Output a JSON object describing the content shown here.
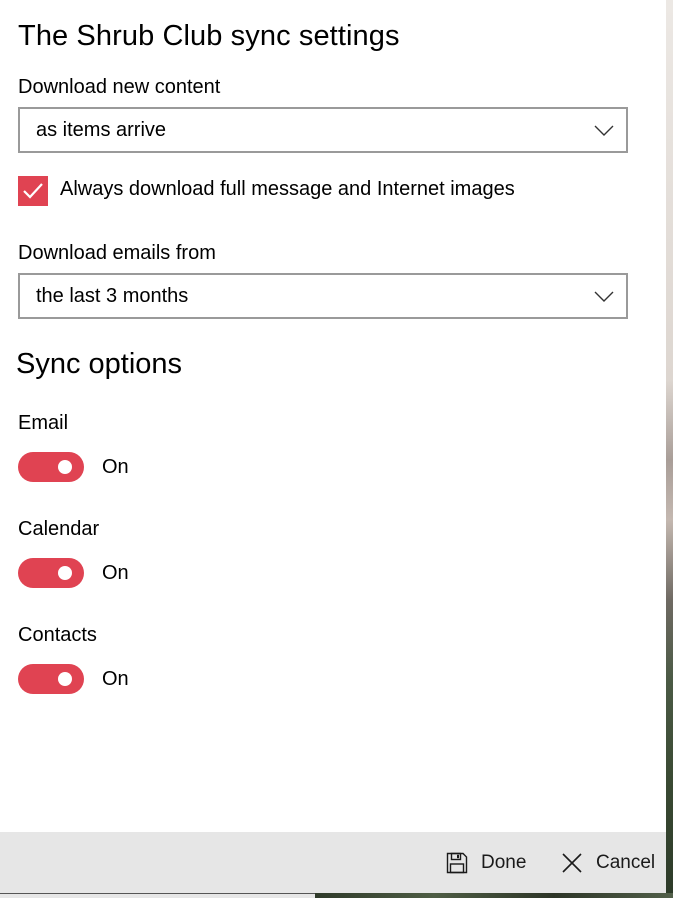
{
  "title": "The Shrub Club sync settings",
  "download_new_content": {
    "label": "Download new content",
    "value": "as items arrive"
  },
  "full_message_checkbox": {
    "label": "Always download full message and Internet images",
    "checked": true
  },
  "download_emails_from": {
    "label": "Download emails from",
    "value": "the last 3 months"
  },
  "sync_options": {
    "heading": "Sync options",
    "items": [
      {
        "label": "Email",
        "state": "On"
      },
      {
        "label": "Calendar",
        "state": "On"
      },
      {
        "label": "Contacts",
        "state": "On"
      }
    ]
  },
  "footer": {
    "done_label": "Done",
    "cancel_label": "Cancel"
  },
  "colors": {
    "accent": "#e04352",
    "footer_bg": "#e6e6e6",
    "select_border": "#9a9a9a"
  },
  "icons": {
    "dropdown": "chevron-down-icon",
    "checkbox": "checkmark-icon",
    "done": "save-icon",
    "cancel": "close-icon"
  }
}
